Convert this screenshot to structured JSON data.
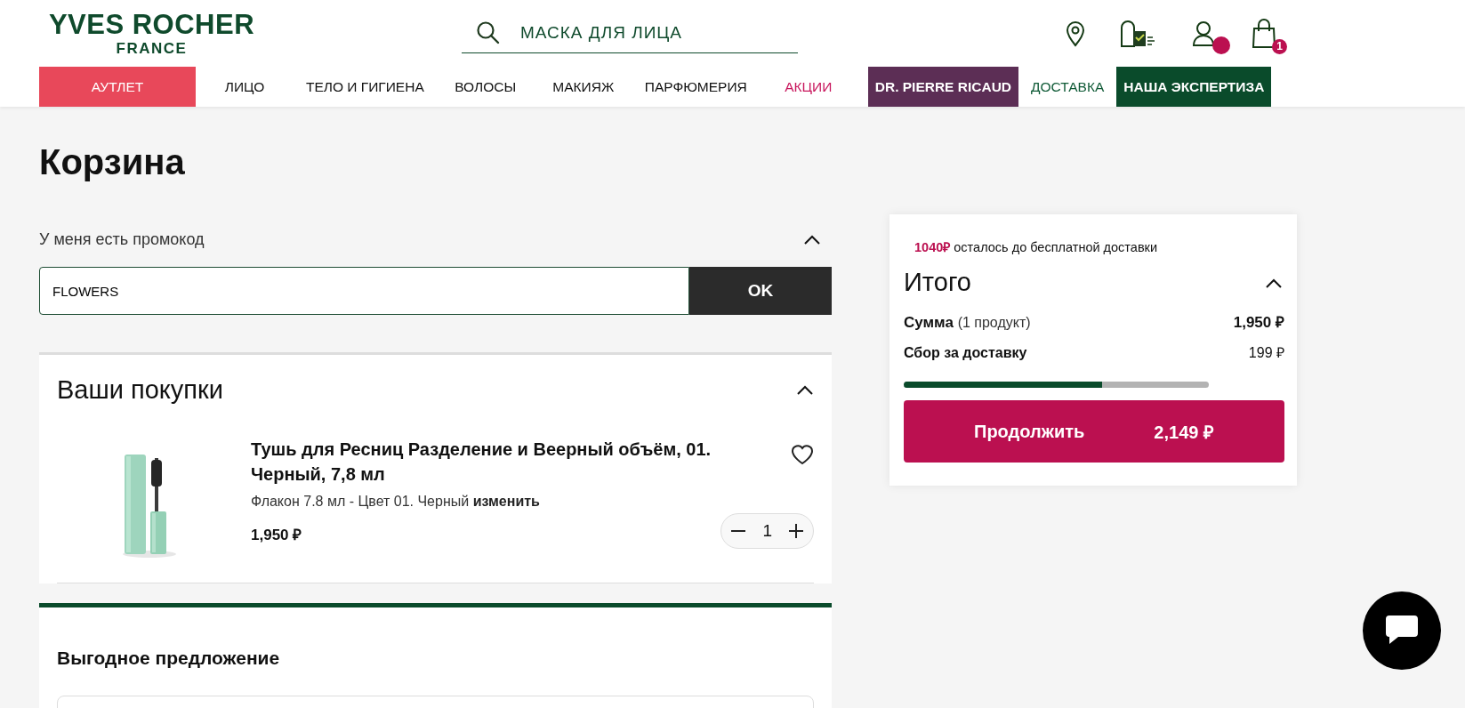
{
  "header": {
    "logo": {
      "brand": "YVES ROCHER",
      "country": "FRANCE"
    },
    "search": {
      "placeholder": "МАСКА ДЛЯ ЛИЦА"
    },
    "cart_count": "1"
  },
  "nav": [
    {
      "label": "АУТЛЕТ",
      "kind": "outlet"
    },
    {
      "label": "ЛИЦО",
      "kind": "plain"
    },
    {
      "label": "ТЕЛО И ГИГИЕНА",
      "kind": "plain"
    },
    {
      "label": "ВОЛОСЫ",
      "kind": "plain"
    },
    {
      "label": "МАКИЯЖ",
      "kind": "plain"
    },
    {
      "label": "ПАРФЮМЕРИЯ",
      "kind": "plain"
    },
    {
      "label": "АКЦИИ",
      "kind": "sale"
    },
    {
      "label": "DR. PIERRE RICAUD",
      "kind": "brand"
    },
    {
      "label": "ДОСТАВКА",
      "kind": "delivery"
    },
    {
      "label": "НАША ЭКСПЕРТИЗА",
      "kind": "expertise"
    }
  ],
  "page_title": "Корзина",
  "promo": {
    "label": "У меня есть промокод",
    "expanded": true,
    "value": "FLOWERS",
    "button": "OK"
  },
  "purchases": {
    "title": "Ваши покупки",
    "expanded": true,
    "items": [
      {
        "kind": "picture",
        "name": "Тушь для Ресниц Разделение и Веерный объём, 01. Черный, 7,8 мл",
        "variant": "Флакон 7.8 мл - Цвет 01. Черный",
        "change": "изменить",
        "price": "1,950 ₽",
        "quantity": "1"
      }
    ]
  },
  "offer": {
    "title": "Выгодное предложение"
  },
  "summary": {
    "free_delivery": {
      "amount": "1040₽",
      "text": "осталось до бесплатной доставки"
    },
    "title": "Итого",
    "expanded": true,
    "sum": {
      "label": "Сумма",
      "count": "(1 продукт)",
      "value": "1,950 ₽"
    },
    "delivery": {
      "label": "Сбор за доставку",
      "value": "199 ₽"
    },
    "progress": {
      "level": 0.65
    },
    "button": {
      "label": "Продолжить",
      "total": "2,149 ₽"
    }
  }
}
